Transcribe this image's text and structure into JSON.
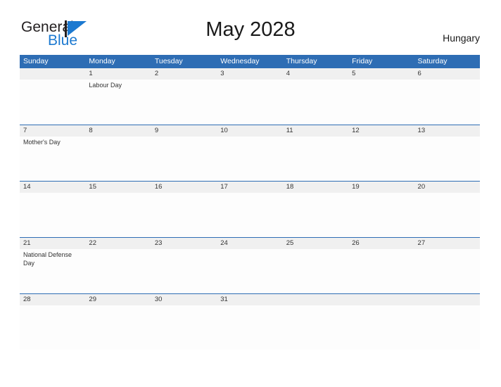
{
  "branding": {
    "logo_general": "General",
    "logo_blue": "Blue",
    "logo_flag_icon": "flag-triangle-icon"
  },
  "header": {
    "title": "May 2028",
    "country": "Hungary"
  },
  "calendar": {
    "weekdays": [
      "Sunday",
      "Monday",
      "Tuesday",
      "Wednesday",
      "Thursday",
      "Friday",
      "Saturday"
    ],
    "accent_color": "#2E6DB4",
    "weeks": [
      [
        {
          "day": "",
          "events": []
        },
        {
          "day": "1",
          "events": [
            "Labour Day"
          ]
        },
        {
          "day": "2",
          "events": []
        },
        {
          "day": "3",
          "events": []
        },
        {
          "day": "4",
          "events": []
        },
        {
          "day": "5",
          "events": []
        },
        {
          "day": "6",
          "events": []
        }
      ],
      [
        {
          "day": "7",
          "events": [
            "Mother's Day"
          ]
        },
        {
          "day": "8",
          "events": []
        },
        {
          "day": "9",
          "events": []
        },
        {
          "day": "10",
          "events": []
        },
        {
          "day": "11",
          "events": []
        },
        {
          "day": "12",
          "events": []
        },
        {
          "day": "13",
          "events": []
        }
      ],
      [
        {
          "day": "14",
          "events": []
        },
        {
          "day": "15",
          "events": []
        },
        {
          "day": "16",
          "events": []
        },
        {
          "day": "17",
          "events": []
        },
        {
          "day": "18",
          "events": []
        },
        {
          "day": "19",
          "events": []
        },
        {
          "day": "20",
          "events": []
        }
      ],
      [
        {
          "day": "21",
          "events": [
            "National Defense Day"
          ]
        },
        {
          "day": "22",
          "events": []
        },
        {
          "day": "23",
          "events": []
        },
        {
          "day": "24",
          "events": []
        },
        {
          "day": "25",
          "events": []
        },
        {
          "day": "26",
          "events": []
        },
        {
          "day": "27",
          "events": []
        }
      ],
      [
        {
          "day": "28",
          "events": []
        },
        {
          "day": "29",
          "events": []
        },
        {
          "day": "30",
          "events": []
        },
        {
          "day": "31",
          "events": []
        },
        {
          "day": "",
          "events": []
        },
        {
          "day": "",
          "events": []
        },
        {
          "day": "",
          "events": []
        }
      ]
    ]
  }
}
